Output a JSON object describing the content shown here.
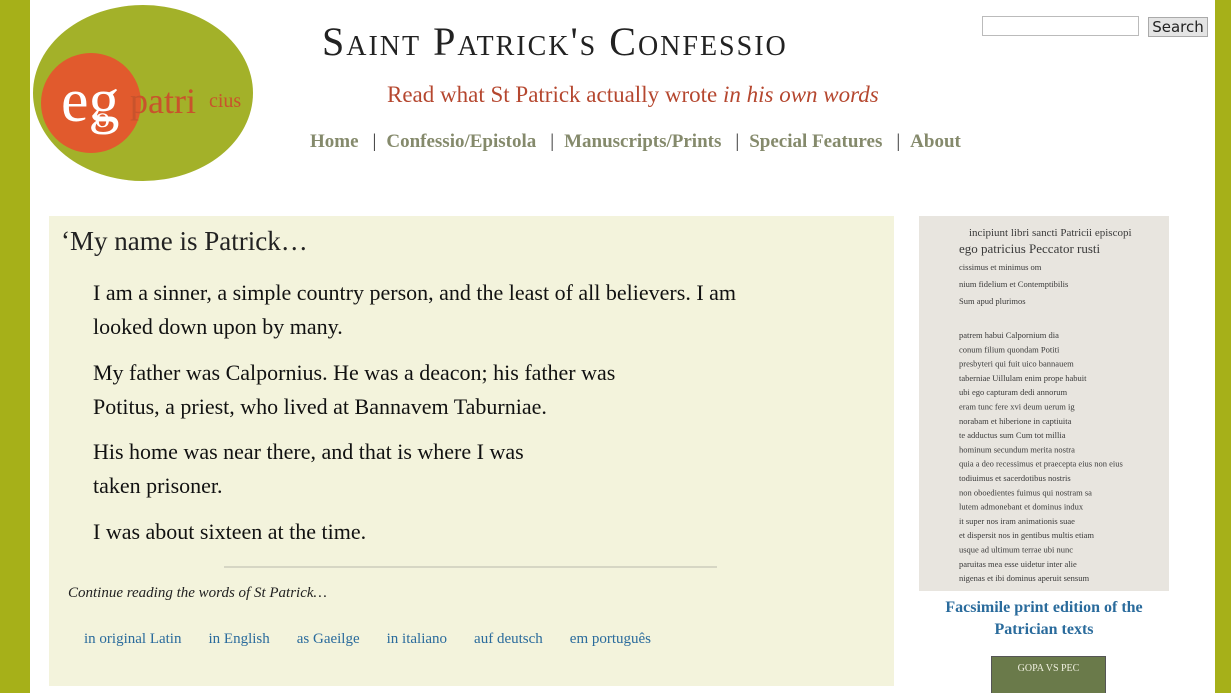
{
  "header": {
    "logo": {
      "glyph": "6",
      "word_eg": "eg",
      "word_o": "o",
      "word_patri": "patri",
      "word_cius": "cius",
      "colors": {
        "circle": "#a3b129",
        "swirl": "#e15a2d",
        "text": "#c8532c"
      }
    },
    "title": "Saint Patrick's Confessio",
    "subtitle_plain": "Read what St Patrick actually wrote",
    "subtitle_italic": "in his own words"
  },
  "search": {
    "placeholder": "",
    "button_label": "Search"
  },
  "nav": {
    "items": [
      {
        "label": "Home"
      },
      {
        "label": "Confessio/Epistola"
      },
      {
        "label": "Manuscripts/Prints"
      },
      {
        "label": "Special Features"
      },
      {
        "label": "About"
      }
    ],
    "separator": "|"
  },
  "main": {
    "lead": "‘My name is Patrick…",
    "paragraphs": [
      {
        "lines": [
          "I am a sinner, a simple country person, and the least of all believers. I am",
          "looked down upon by many."
        ]
      },
      {
        "lines": [
          "My father was Calpornius. He was a deacon; his father was",
          "Potitus, a priest, who lived at Bannavem Taburniae."
        ]
      },
      {
        "lines": [
          "His home was near there, and that is where I was",
          "taken prisoner."
        ]
      },
      {
        "lines": [
          "I was about sixteen at the time."
        ]
      }
    ],
    "continue_text": "Continue reading the words of St Patrick…",
    "languages": [
      "in original Latin",
      "in English",
      "as Gaeilge",
      "in italiano",
      "auf deutsch",
      "em português"
    ]
  },
  "sidebar": {
    "facsimile_lines": [
      "incipiunt libri sancti Patricii episcopi",
      "ego patricius Peccator rusti",
      "cissimus et minimus om",
      "nium fidelium et Contemptibilis",
      "Sum apud plurimos",
      "patrem habui Calpornium dia",
      "conum filium quondam Potiti",
      "presbyteri qui fuit uico bannauem",
      "taberniae Uillulam enim prope habuit",
      "ubi ego capturam dedi annorum",
      "eram tunc fere xvi deum uerum ig",
      "norabam et hiberione in captiuita",
      "te adductus sum Cum tot millia",
      "hominum secundum merita nostra",
      "quia a deo recessimus et praecepta eius non eius",
      "todiuimus et sacerdotibus nostris",
      "non oboedientes fuimus qui nostram sa",
      "lutem admonebant et dominus indux",
      "it super nos iram animationis suae",
      "et dispersit nos in gentibus multis etiam",
      "usque ad ultimum terrae ubi nunc",
      "paruitas mea esse uidetur inter alie",
      "nigenas et ibi dominus aperuit sensum"
    ],
    "caption": "Facsimile print edition of the Patrician texts",
    "thumb_text": "GOPA VS PEC"
  },
  "colors": {
    "frame": "#a6b019",
    "content_bg": "#f3f3dc",
    "nav": "#858a6c",
    "link": "#2a6b9c",
    "subtitle": "#b5472f"
  }
}
